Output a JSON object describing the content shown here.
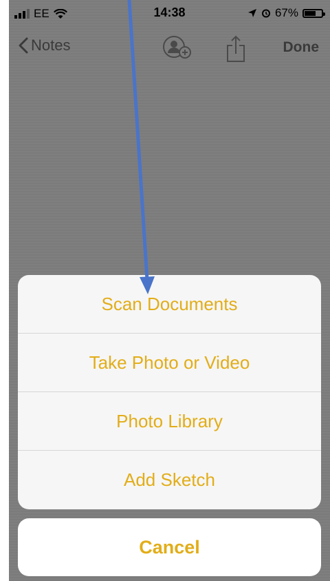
{
  "status_bar": {
    "carrier": "EE",
    "time": "14:38",
    "battery_percent": "67%",
    "battery_level": 0.67
  },
  "nav": {
    "back_label": "Notes",
    "done_label": "Done"
  },
  "action_sheet": {
    "options": [
      {
        "label": "Scan Documents"
      },
      {
        "label": "Take Photo or Video"
      },
      {
        "label": "Photo Library"
      },
      {
        "label": "Add Sketch"
      }
    ],
    "cancel_label": "Cancel"
  },
  "colors": {
    "accent": "#e2ad18",
    "dim_overlay": "#7d7d7d",
    "annotation_arrow": "#4a74c9"
  }
}
